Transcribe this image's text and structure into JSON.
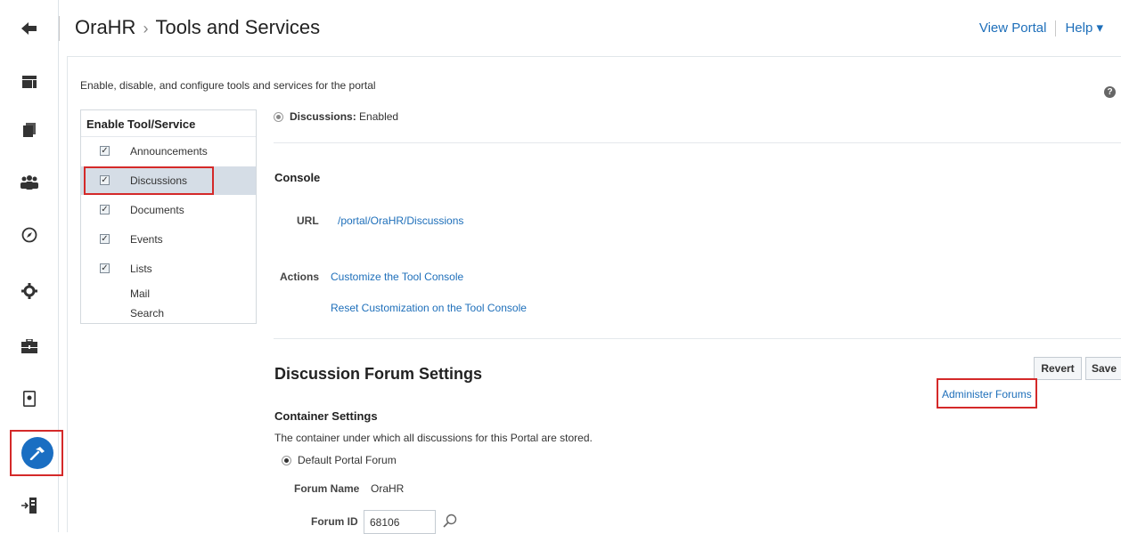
{
  "header": {
    "app": "OraHR",
    "breadcrumb_sep": "›",
    "page": "Tools and Services",
    "view_portal": "View Portal",
    "help": "Help ▾"
  },
  "rail": {
    "icons": [
      "back-arrow-icon",
      "layout-icon",
      "pages-icon",
      "members-icon",
      "compass-icon",
      "gear-icon",
      "assets-icon",
      "device-icon",
      "hammer-icon",
      "exit-icon"
    ],
    "active": "hammer-icon"
  },
  "main": {
    "intro": "Enable, disable, and configure tools and services for the portal",
    "help_icon": "?",
    "tools_table": {
      "col_enable": "Enable",
      "col_tool": "Tool/Service",
      "rows": [
        {
          "label": "Announcements",
          "enabled": true
        },
        {
          "label": "Discussions",
          "enabled": true,
          "selected": true
        },
        {
          "label": "Documents",
          "enabled": true
        },
        {
          "label": "Events",
          "enabled": true
        },
        {
          "label": "Lists",
          "enabled": true
        },
        {
          "label": "Mail",
          "enabled": null
        },
        {
          "label": "Search",
          "enabled": null
        }
      ],
      "check_glyph": "✓"
    },
    "status_label": "Discussions:",
    "status_value": "Enabled",
    "console": {
      "title": "Console",
      "url_label": "URL",
      "url_value": "/portal/OraHR/Discussions",
      "actions_label": "Actions",
      "action_1": "Customize the Tool Console",
      "action_2": "Reset Customization on the Tool Console"
    },
    "forum_settings": {
      "title": "Discussion Forum Settings",
      "revert": "Revert",
      "save": "Save",
      "administer": "Administer Forums",
      "container_title": "Container Settings",
      "container_desc": "The container under which all discussions for this Portal are stored.",
      "default_option": "Default Portal Forum",
      "forum_name_label": "Forum Name",
      "forum_name_value": "OraHR",
      "forum_id_label": "Forum ID",
      "forum_id_value": "68106"
    }
  },
  "colors": {
    "accent": "#1e6fba",
    "highlight": "#d42929",
    "active_circle": "#1a6ec2",
    "selected_row": "#d5dde6"
  }
}
